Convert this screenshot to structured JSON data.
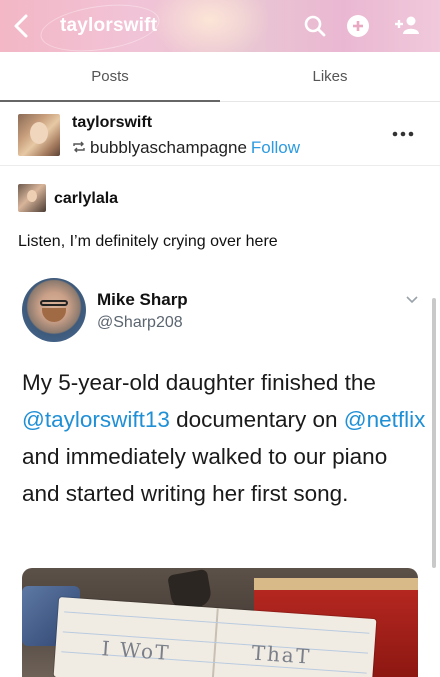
{
  "header": {
    "title": "taylorswift",
    "icons": [
      "back-arrow-icon",
      "search-icon",
      "compose-icon",
      "follow-user-icon"
    ]
  },
  "tabs": [
    {
      "label": "Posts",
      "active": true
    },
    {
      "label": "Likes",
      "active": false
    }
  ],
  "post": {
    "username": "taylorswift",
    "reblogged_from": "bubblyaschampagne",
    "follow_label": "Follow",
    "more_icon": "more-dots-icon"
  },
  "reblog": {
    "username": "carlylala",
    "text": "Listen, I’m definitely crying over here"
  },
  "tweet": {
    "name": "Mike Sharp",
    "handle": "@Sharp208",
    "body_1": "My 5-year-old daughter finished the ",
    "mention_1": "@taylorswift13",
    "body_2": " documentary on ",
    "mention_2": "@netflix",
    "body_3": " and immediately walked to our piano and started writing her first song.",
    "photo_text_left": "I WoT",
    "photo_text_right": "ThaT"
  },
  "colors": {
    "accent_link": "#2c9be0",
    "mention": "#1f8fd6"
  }
}
